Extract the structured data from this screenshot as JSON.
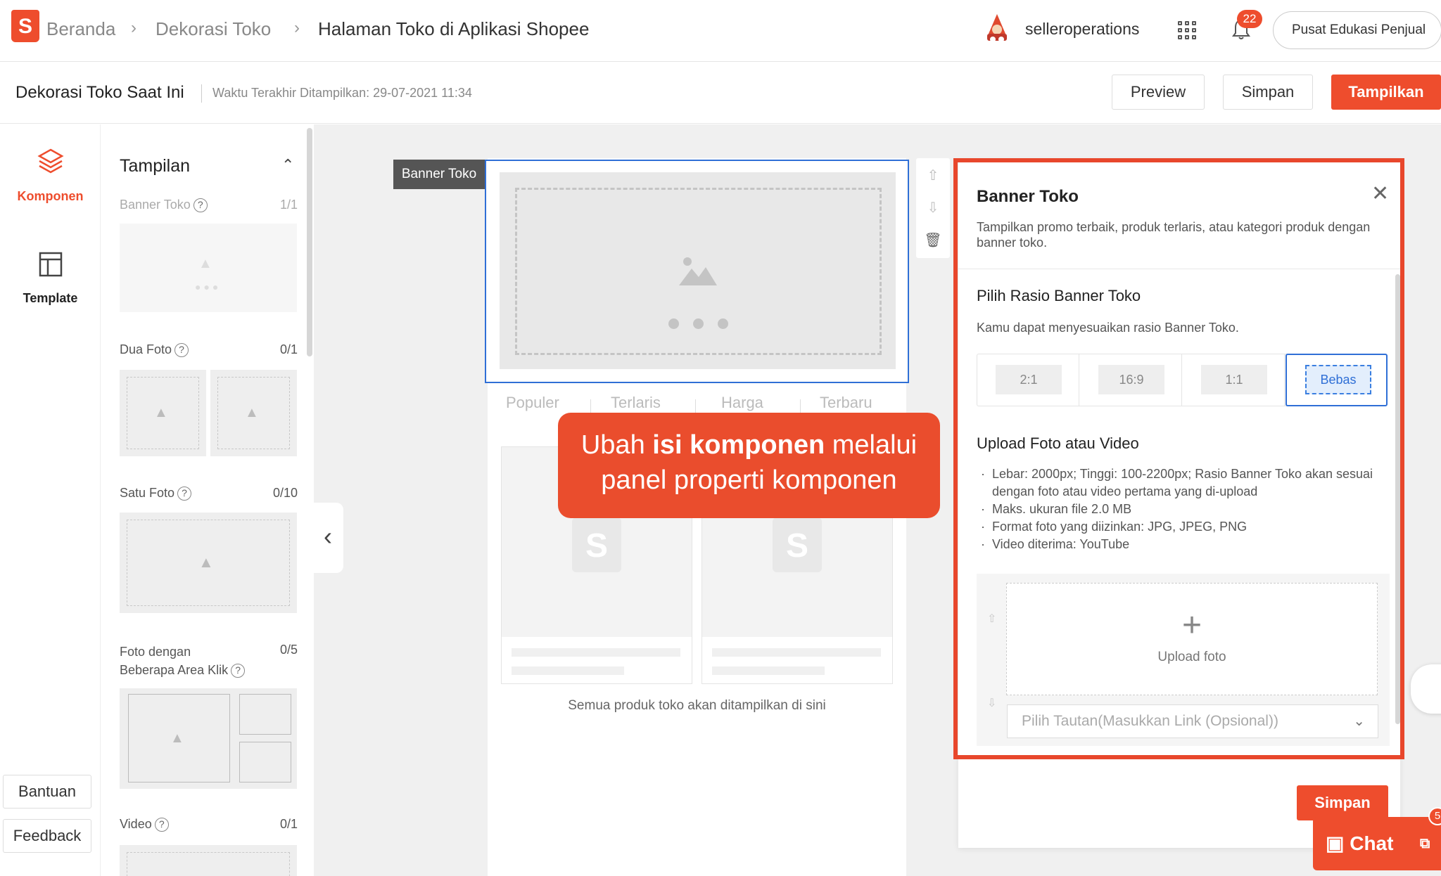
{
  "breadcrumb": [
    "Beranda",
    "Dekorasi Toko",
    "Halaman Toko di Aplikasi Shopee"
  ],
  "header": {
    "username": "selleroperations",
    "notification_count": "22",
    "edu_button": "Pusat Edukasi Penjual"
  },
  "subheader": {
    "title": "Dekorasi Toko Saat Ini",
    "last_shown": "Waktu Terakhir Ditampilkan: 29-07-2021 11:34",
    "preview": "Preview",
    "save": "Simpan",
    "publish": "Tampilkan"
  },
  "leftnav": {
    "items": [
      "Komponen",
      "Template"
    ],
    "help": "Bantuan",
    "feedback": "Feedback"
  },
  "components": {
    "section_title": "Tampilan",
    "items": [
      {
        "label": "Banner Toko",
        "count": "1/1"
      },
      {
        "label": "Dua Foto",
        "count": "0/1"
      },
      {
        "label": "Satu Foto",
        "count": "0/10"
      },
      {
        "label": "Foto dengan Beberapa Area Klik",
        "count": "0/5"
      },
      {
        "label": "Video",
        "count": "0/1"
      }
    ]
  },
  "canvas": {
    "banner_tag": "Banner Toko",
    "tabs": [
      "Populer",
      "Terlaris",
      "Harga",
      "Terbaru"
    ],
    "all_products_note": "Semua produk toko akan ditampilkan di sini"
  },
  "callout": {
    "pre": "Ubah ",
    "bold": "isi komponen",
    "post": " melalui panel properti komponen"
  },
  "panel": {
    "title": "Banner Toko",
    "description": "Tampilkan promo terbaik, produk terlaris, atau kategori produk dengan banner toko.",
    "ratio_heading": "Pilih Rasio Banner Toko",
    "ratio_desc": "Kamu dapat menyesuaikan rasio Banner Toko.",
    "ratios": [
      "2:1",
      "16:9",
      "1:1",
      "Bebas"
    ],
    "selected_ratio": "Bebas",
    "upload_heading": "Upload Foto atau Video",
    "requirements": [
      "Lebar: 2000px; Tinggi: 100-2200px; Rasio Banner Toko akan sesuai dengan foto atau video pertama yang di-upload",
      "Maks. ukuran file 2.0 MB",
      "Format foto yang diizinkan: JPG, JPEG, PNG",
      "Video diterima: YouTube"
    ],
    "upload_label": "Upload foto",
    "link_placeholder": "Pilih Tautan(Masukkan Link (Opsional))",
    "save": "Simpan"
  },
  "chat": {
    "label": "Chat",
    "badge": "5"
  },
  "colors": {
    "brand": "#ee4d2d",
    "selection": "#2f6fd6",
    "highlight": "#e8472c"
  }
}
